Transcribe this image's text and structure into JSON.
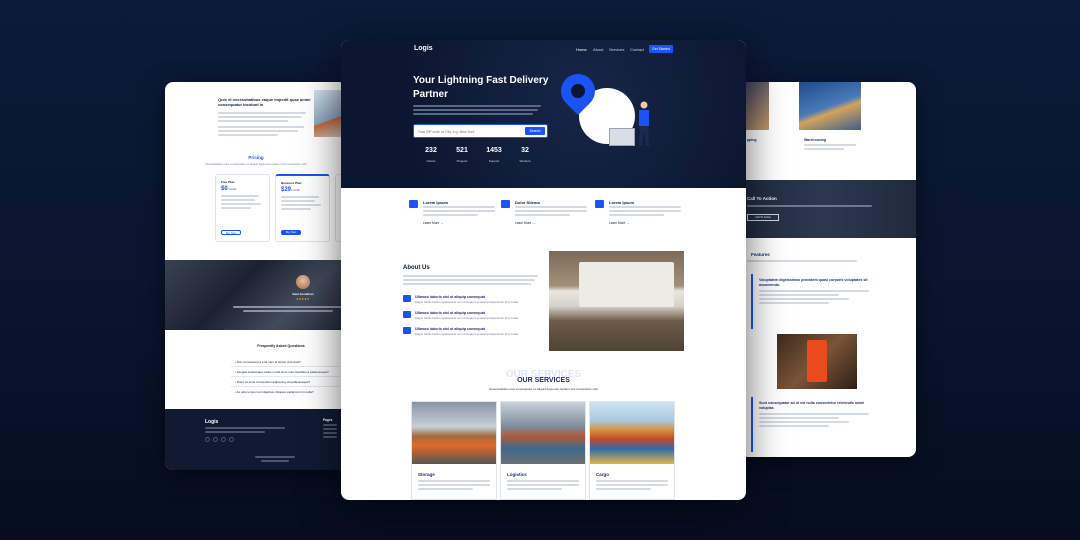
{
  "left_page": {
    "hero_title": "Quis et necessitatibus eaque impedit quae animi consequatur incidunt in",
    "pricing_title": "Pricing",
    "pricing_subtitle": "Necessitatibus eius consequatur ex aliquid fuga eum quidem sint consectetur velit",
    "plans": [
      {
        "name": "Free Plan",
        "price": "$0",
        "period": "/ month",
        "button": "Buy Now"
      },
      {
        "name": "Business Plan",
        "price": "$29",
        "period": "/ month",
        "button": "Buy Now"
      }
    ],
    "testimonial_name": "Saul Goodman",
    "faq_title": "Frequently Asked Questions",
    "faq_items": [
      "Non consectetur a erat nam at lectus urna duis?",
      "Feugiat scelerisque varius morbi enim nunc faucibus a pellentesque?",
      "Dolor sit amet consectetur adipiscing elit pellentesque?",
      "Ac odio tempor orci dapibus. Aliquam eleifend mi in nulla?"
    ],
    "footer_logo": "Logis",
    "footer_links_title": "Pages"
  },
  "center_page": {
    "nav": {
      "logo": "Logis",
      "links": [
        "Home",
        "About",
        "Services",
        "Contact"
      ],
      "cta": "Get Started"
    },
    "hero": {
      "title": "Your Lightning Fast Delivery Partner",
      "search_placeholder": "Your ZIP code or City. e.g. New York",
      "search_button": "Search",
      "stats": [
        {
          "value": "232",
          "label": "Clients"
        },
        {
          "value": "521",
          "label": "Projects"
        },
        {
          "value": "1453",
          "label": "Support"
        },
        {
          "value": "32",
          "label": "Workers"
        }
      ]
    },
    "features": [
      {
        "title": "Lorem Ipsum",
        "link": "Learn More"
      },
      {
        "title": "Dolor Sitema",
        "link": "Learn More"
      },
      {
        "title": "Lorem Ipsum",
        "link": "Learn More"
      }
    ],
    "about": {
      "title": "About Us",
      "items": [
        {
          "title": "Ullamco laboris nisi ut aliquip consequat",
          "desc": "Magni facilis facilis repellendus cum excepturi quaerat praesentium libre trade"
        },
        {
          "title": "Ullamco laboris nisi ut aliquip consequat",
          "desc": "Magni facilis facilis repellendus cum excepturi quaerat praesentium libre trade"
        },
        {
          "title": "Ullamco laboris nisi ut aliquip consequat",
          "desc": "Magni facilis facilis repellendus cum excepturi quaerat praesentium libre trade"
        }
      ]
    },
    "services": {
      "ghost_title": "OUR SERVICES",
      "title": "OUR SERVICES",
      "subtitle": "Necessitatibus eius consequatur ex aliquid fuga eum quidem sint consectetur velit",
      "cards": [
        {
          "title": "Storage"
        },
        {
          "title": "Logistics"
        },
        {
          "title": "Cargo"
        }
      ]
    }
  },
  "right_page": {
    "card_labels": [
      "pping",
      "Warehousing"
    ],
    "cta_title": "Call To Action",
    "cta_button": "Call To Action",
    "features_title": "Features",
    "feature_blocks": [
      "Voluptatem dignissimos provident quasi corporis voluptates sit assumenda.",
      "Sunt consequatur ad ut est nulla consectetur reiciendis animi voluptas"
    ]
  },
  "colors": {
    "accent": "#1a54f6",
    "navy": "#0b1631",
    "heading": "#1a2d7a"
  }
}
